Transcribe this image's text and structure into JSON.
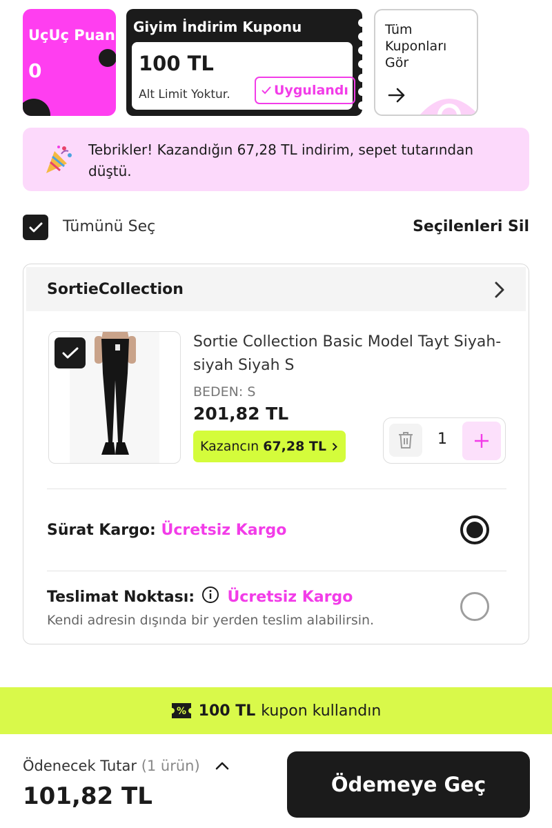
{
  "puan_card": {
    "title": "UçUç Puan",
    "value": "0"
  },
  "coupon": {
    "title": "Giyim İndirim Kuponu",
    "amount": "100 TL",
    "limit": "Alt Limit Yoktur.",
    "status": "Uygulandı",
    "status_icon": "check-icon"
  },
  "all_coupons": {
    "label": "Tüm Kuponları Gör",
    "arrow_icon": "arrow-right-icon"
  },
  "banner": {
    "icon": "party-popper-icon",
    "text": "Tebrikler! Kazandığın 67,28 TL indirim, sepet tutarından düştü."
  },
  "select_all": {
    "label": "Tümünü Seç",
    "checked": true,
    "delete_label": "Seçilenleri Sil"
  },
  "seller": {
    "name": "SortieCollection",
    "product": {
      "title": "Sortie Collection Basic Model Tayt Siyah-siyah Siyah S",
      "size": "BEDEN: S",
      "price": "201,82 TL",
      "gain_label": "Kazancın",
      "gain_amount": "67,28 TL",
      "quantity": "1",
      "checked": true
    },
    "shipping": [
      {
        "label": "Sürat Kargo:",
        "price": "Ücretsiz Kargo",
        "selected": true
      },
      {
        "label": "Teslimat Noktası:",
        "price": "Ücretsiz Kargo",
        "description": "Kendi adresin dışında bir yerden teslim alabilirsin.",
        "selected": false
      }
    ]
  },
  "coupon_used": {
    "icon": "percent-ticket-icon",
    "amount": "100 TL",
    "text": "kupon kullandın"
  },
  "footer": {
    "total_label": "Ödenecek Tutar",
    "item_count": "(1 ürün)",
    "total": "101,82 TL",
    "pay_label": "Ödemeye Geç"
  },
  "colors": {
    "brand_pink": "#f23ce8",
    "lime": "#d4fc3b",
    "dark": "#1b1b1b",
    "banner_pink": "#fcd9fb"
  }
}
